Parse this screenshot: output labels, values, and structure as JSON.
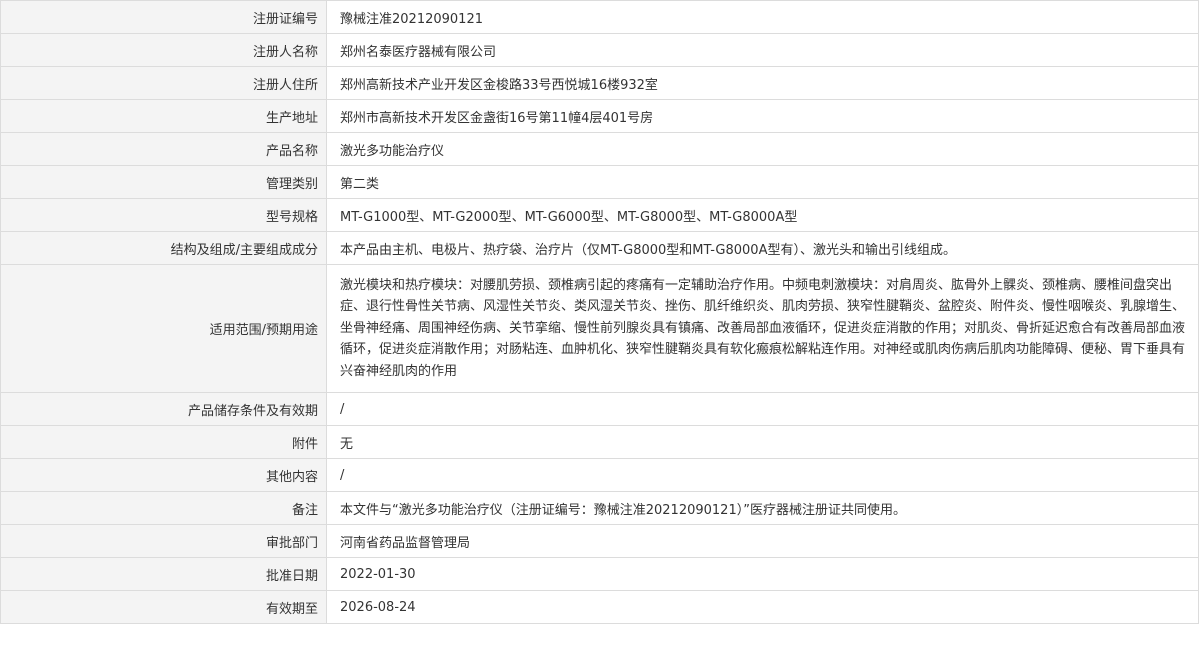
{
  "rows": [
    {
      "label": "注册证编号",
      "value": "豫械注准20212090121"
    },
    {
      "label": "注册人名称",
      "value": "郑州名泰医疗器械有限公司"
    },
    {
      "label": "注册人住所",
      "value": "郑州高新技术产业开发区金梭路33号西悦城16楼932室"
    },
    {
      "label": "生产地址",
      "value": "郑州市高新技术开发区金盏街16号第11幢4层401号房"
    },
    {
      "label": "产品名称",
      "value": "激光多功能治疗仪"
    },
    {
      "label": "管理类别",
      "value": "第二类"
    },
    {
      "label": "型号规格",
      "value": "MT-G1000型、MT-G2000型、MT-G6000型、MT-G8000型、MT-G8000A型"
    },
    {
      "label": "结构及组成/主要组成成分",
      "value": "本产品由主机、电极片、热疗袋、治疗片（仅MT-G8000型和MT-G8000A型有）、激光头和输出引线组成。"
    },
    {
      "label": "适用范围/预期用途",
      "value": "激光模块和热疗模块：对腰肌劳损、颈椎病引起的疼痛有一定辅助治疗作用。中频电刺激模块：对肩周炎、肱骨外上髁炎、颈椎病、腰椎间盘突出症、退行性骨性关节病、风湿性关节炎、类风湿关节炎、挫伤、肌纤维织炎、肌肉劳损、狭窄性腱鞘炎、盆腔炎、附件炎、慢性咽喉炎、乳腺增生、坐骨神经痛、周围神经伤病、关节挛缩、慢性前列腺炎具有镇痛、改善局部血液循环，促进炎症消散的作用；对肌炎、骨折延迟愈合有改善局部血液循环，促进炎症消散作用；对肠粘连、血肿机化、狭窄性腱鞘炎具有软化瘢痕松解粘连作用。对神经或肌肉伤病后肌肉功能障碍、便秘、胃下垂具有兴奋神经肌肉的作用"
    },
    {
      "label": "产品储存条件及有效期",
      "value": "/"
    },
    {
      "label": "附件",
      "value": "无"
    },
    {
      "label": "其他内容",
      "value": "/"
    },
    {
      "label": "备注",
      "value": "本文件与“激光多功能治疗仪（注册证编号：豫械注准20212090121）”医疗器械注册证共同使用。"
    },
    {
      "label": "审批部门",
      "value": "河南省药品监督管理局"
    },
    {
      "label": "批准日期",
      "value": "2022-01-30"
    },
    {
      "label": "有效期至",
      "value": "2026-08-24"
    }
  ]
}
